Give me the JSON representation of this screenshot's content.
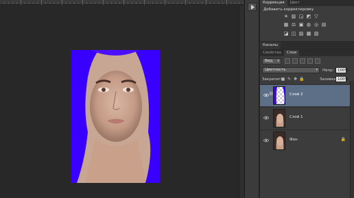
{
  "panels": {
    "adjustments": {
      "tabs": [
        {
          "label": "Коррекция",
          "active": true
        },
        {
          "label": "Цвет",
          "active": false
        }
      ],
      "title": "Добавить корректировку",
      "icon_rows": [
        [
          "sun-icon",
          "levels-icon",
          "curves-icon",
          "exposure-icon",
          "vibrance-icon"
        ],
        [
          "hue-saturation-icon",
          "color-balance-icon",
          "black-white-icon",
          "photo-filter-icon",
          "channel-mixer-icon",
          "color-lookup-icon"
        ],
        [
          "invert-icon",
          "posterize-icon",
          "threshold-icon",
          "gradient-map-icon",
          "selective-color-icon"
        ]
      ],
      "icon_glyphs": [
        "☀",
        "▥",
        "◲",
        "◩",
        "▽",
        "▦",
        "⚖",
        "▣",
        "◍",
        "◎",
        "▤",
        "◪",
        "◫",
        "▨",
        "▩",
        "▧"
      ]
    },
    "channels": {
      "tab_label": "Каналы"
    },
    "layers": {
      "tabs": [
        {
          "label": "Свойства",
          "active": false
        },
        {
          "label": "Слои",
          "active": true
        }
      ],
      "filter_select": "Вид",
      "blend_mode": "Цветность",
      "opacity_label": "Непр:",
      "opacity_value": "100%",
      "lock_label": "Закрепить:",
      "fill_label": "Заливка:",
      "fill_value": "100%",
      "items": [
        {
          "name": "Слой 2",
          "selected": true,
          "visible": true,
          "locked": false,
          "thumb": "mask"
        },
        {
          "name": "Слой 1",
          "selected": false,
          "visible": true,
          "locked": false,
          "thumb": "face"
        },
        {
          "name": "Фон",
          "selected": false,
          "visible": true,
          "locked": true,
          "thumb": "face"
        }
      ]
    }
  },
  "colors": {
    "selection_highlight": "#5d6f86",
    "overlay_blue": "#3a00ff"
  }
}
